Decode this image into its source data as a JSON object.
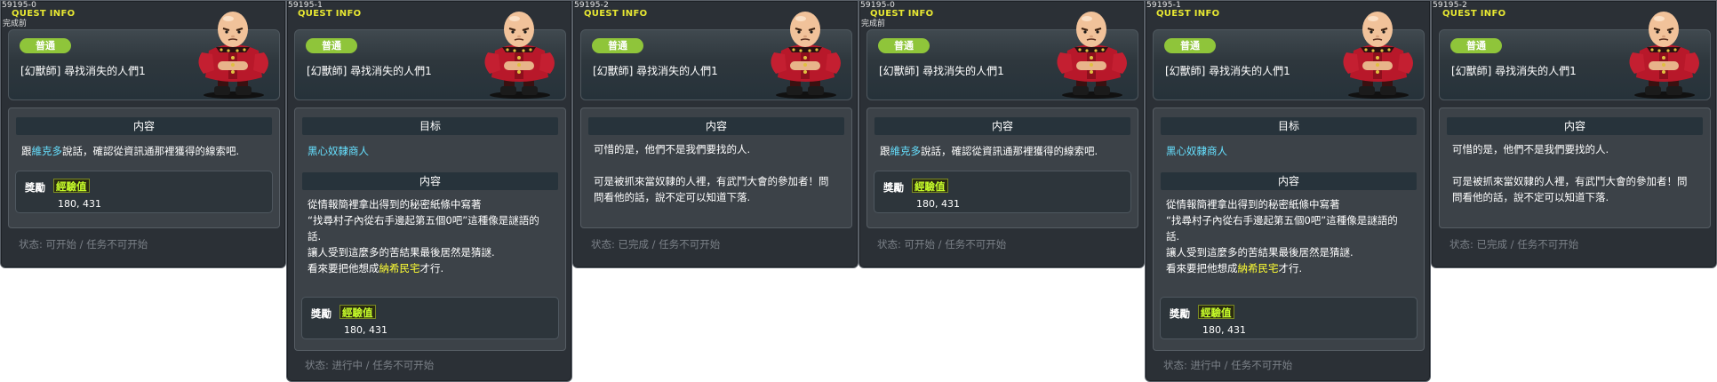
{
  "panels": [
    {
      "id": "59195-0",
      "header": "QUEST INFO",
      "sub": "完成前",
      "badge": "普通",
      "title": "[幻獸師] 尋找消失的人們1",
      "sections": [
        {
          "label": "内容",
          "lines": [
            [
              {
                "t": "跟"
              },
              {
                "t": "維克多",
                "c": "npc"
              },
              {
                "t": "說話，確認從資訊通那裡獲得的線索吧."
              }
            ]
          ]
        }
      ],
      "reward_label": "獎勵",
      "reward_exp_label": "經驗值",
      "reward_exp_value": "180, 431",
      "status": "状态:  可开始  /  任务不可开始"
    },
    {
      "id": "59195-1",
      "header": "QUEST INFO",
      "sub": "",
      "badge": "普通",
      "title": "[幻獸師] 尋找消失的人們1",
      "sections": [
        {
          "label": "目标",
          "lines": [
            [
              {
                "t": "黑心奴隸商人",
                "c": "npc"
              }
            ]
          ]
        },
        {
          "label": "内容",
          "lines": [
            [
              {
                "t": "從情報簡裡拿出得到的秘密紙條中寫著"
              }
            ],
            [
              {
                "t": "“找尋村子內從右手邊起第五個0吧”這種像是謎語的"
              }
            ],
            [
              {
                "t": "話."
              }
            ],
            [
              {
                "t": "讓人受到這麼多的苦結果最後居然是猜謎."
              }
            ],
            [
              {
                "t": "看來要把他想成"
              },
              {
                "t": "納希民宅",
                "c": "item"
              },
              {
                "t": "才行."
              }
            ]
          ]
        }
      ],
      "reward_label": "獎勵",
      "reward_exp_label": "經驗值",
      "reward_exp_value": "180, 431",
      "status": "状态:  进行中  /  任务不可开始"
    },
    {
      "id": "59195-2",
      "header": "QUEST INFO",
      "sub": "",
      "badge": "普通",
      "title": "[幻獸師] 尋找消失的人們1",
      "sections": [
        {
          "label": "内容",
          "lines": [
            [
              {
                "t": "可惜的是，他們不是我們要找的人."
              }
            ],
            [
              {
                "t": ""
              }
            ],
            [
              {
                "t": "可是被抓來當奴隸的人裡，有武鬥大會的參加者！問"
              }
            ],
            [
              {
                "t": "問看他的話，說不定可以知道下落."
              }
            ]
          ]
        }
      ],
      "reward_label": "",
      "reward_exp_label": "",
      "reward_exp_value": "",
      "status": "状态:  已完成  /  任务不可开始"
    }
  ],
  "panels_repeat": [
    {
      "id": "59195-0",
      "sub": "完成前",
      "status": "状态:  可开始  /  任务不可开始"
    },
    {
      "id": "59195-1",
      "sub": "",
      "status": "状态:  进行中  /  任务不可开始"
    },
    {
      "id": "59195-2",
      "sub": "",
      "status": "状态:  已完成  /  任务不可开始"
    }
  ],
  "colors": {
    "panel_bg": "#2b3036",
    "badge_green": "#8fc53a",
    "npc_highlight": "#66e0ff",
    "item_highlight": "#ffff33",
    "header_yellow": "#e8e832",
    "status_gray": "#7b8188"
  }
}
